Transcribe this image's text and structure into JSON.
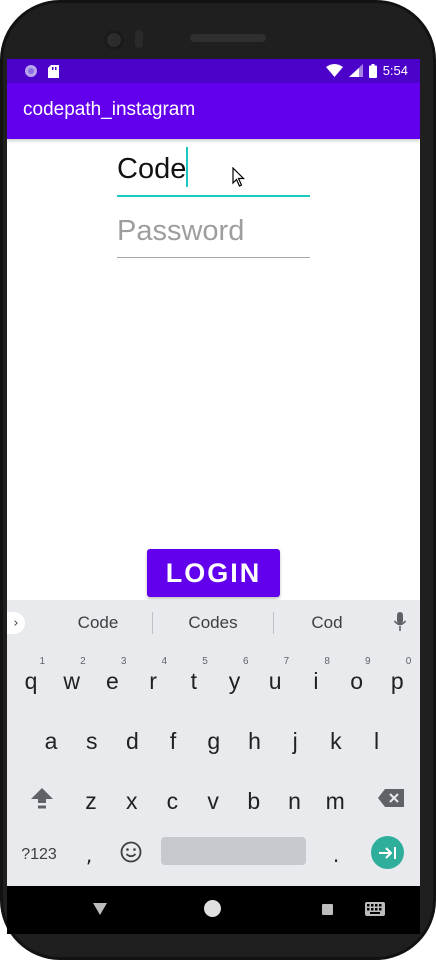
{
  "status_bar": {
    "time": "5:54",
    "icons_left": [
      "media-icon",
      "sd-card-icon"
    ],
    "icons_right": [
      "wifi-icon",
      "signal-icon",
      "battery-icon"
    ],
    "color": "#4b03c9"
  },
  "app_bar": {
    "title": "codepath_instagram",
    "color": "#6200ee"
  },
  "form": {
    "username_value": "Code",
    "password_placeholder": "Password",
    "focus_color": "#1cc9c0"
  },
  "login_button": {
    "label": "LOGIN",
    "color": "#6200ee"
  },
  "keyboard": {
    "suggestions": [
      "Code",
      "Codes",
      "Cod"
    ],
    "rows": [
      [
        {
          "k": "q",
          "h": "1"
        },
        {
          "k": "w",
          "h": "2"
        },
        {
          "k": "e",
          "h": "3"
        },
        {
          "k": "r",
          "h": "4"
        },
        {
          "k": "t",
          "h": "5"
        },
        {
          "k": "y",
          "h": "6"
        },
        {
          "k": "u",
          "h": "7"
        },
        {
          "k": "i",
          "h": "8"
        },
        {
          "k": "o",
          "h": "9"
        },
        {
          "k": "p",
          "h": "0"
        }
      ],
      [
        {
          "k": "a"
        },
        {
          "k": "s"
        },
        {
          "k": "d"
        },
        {
          "k": "f"
        },
        {
          "k": "g"
        },
        {
          "k": "h"
        },
        {
          "k": "j"
        },
        {
          "k": "k"
        },
        {
          "k": "l"
        }
      ],
      [
        {
          "k": "z"
        },
        {
          "k": "x"
        },
        {
          "k": "c"
        },
        {
          "k": "v"
        },
        {
          "k": "b"
        },
        {
          "k": "n"
        },
        {
          "k": "m"
        }
      ]
    ],
    "symbols_label": "?123",
    "comma": ",",
    "period": ".",
    "enter_color": "#2fae9c"
  },
  "nav_bar": {
    "icons": [
      "back-icon",
      "home-icon",
      "recents-icon",
      "keyboard-switch-icon"
    ]
  }
}
